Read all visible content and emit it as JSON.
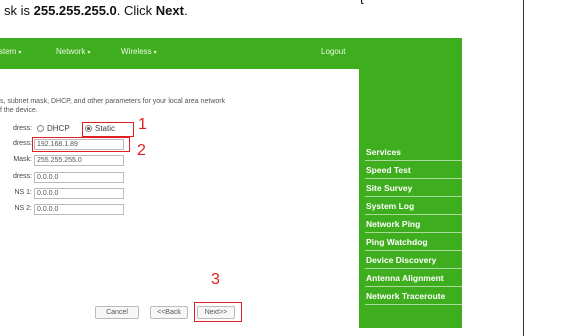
{
  "instruction": {
    "line1_tail": "t",
    "line2_prefix": "sk is ",
    "mask_value": "255.255.255.0",
    "line2_mid": ". Click ",
    "next_word": "Next",
    "line2_suffix": "."
  },
  "topnav": {
    "system": "stem",
    "network": "Network",
    "wireless": "Wireless",
    "logout": "Logout",
    "caret": "▾"
  },
  "panel": {
    "description_line1": "s, subnet mask, DHCP, and other parameters for your local area network",
    "description_line2": "f the device.",
    "rows": {
      "ip_mode_label": "dress:",
      "dhcp_label": "DHCP",
      "static_label": "Static",
      "ip_label": "dress:",
      "ip_value": "192.168.1.89",
      "mask_label": "Mask:",
      "mask_value": "255.255.255.0",
      "gateway_label": "dress:",
      "gateway_value": "0.0.0.0",
      "dns1_label": "NS 1:",
      "dns1_value": "0.0.0.0",
      "dns2_label": "NS 2:",
      "dns2_value": "0.0.0.0"
    },
    "selected_mode": "Static",
    "buttons": {
      "cancel": "Cancel",
      "back": "<<Back",
      "next": "Next>>"
    }
  },
  "annotations": {
    "step1": "1",
    "step2": "2",
    "step3": "3",
    "color": "#e02020"
  },
  "sidebar": {
    "items": [
      {
        "label": "Services"
      },
      {
        "label": "Speed Test"
      },
      {
        "label": "Site Survey"
      },
      {
        "label": "System Log"
      },
      {
        "label": "Network Ping"
      },
      {
        "label": "Ping Watchdog"
      },
      {
        "label": "Device Discovery"
      },
      {
        "label": "Antenna Alignment"
      },
      {
        "label": "Network Traceroute"
      }
    ]
  },
  "colors": {
    "brand_green": "#3fae1e",
    "highlight_red": "#e02020"
  }
}
